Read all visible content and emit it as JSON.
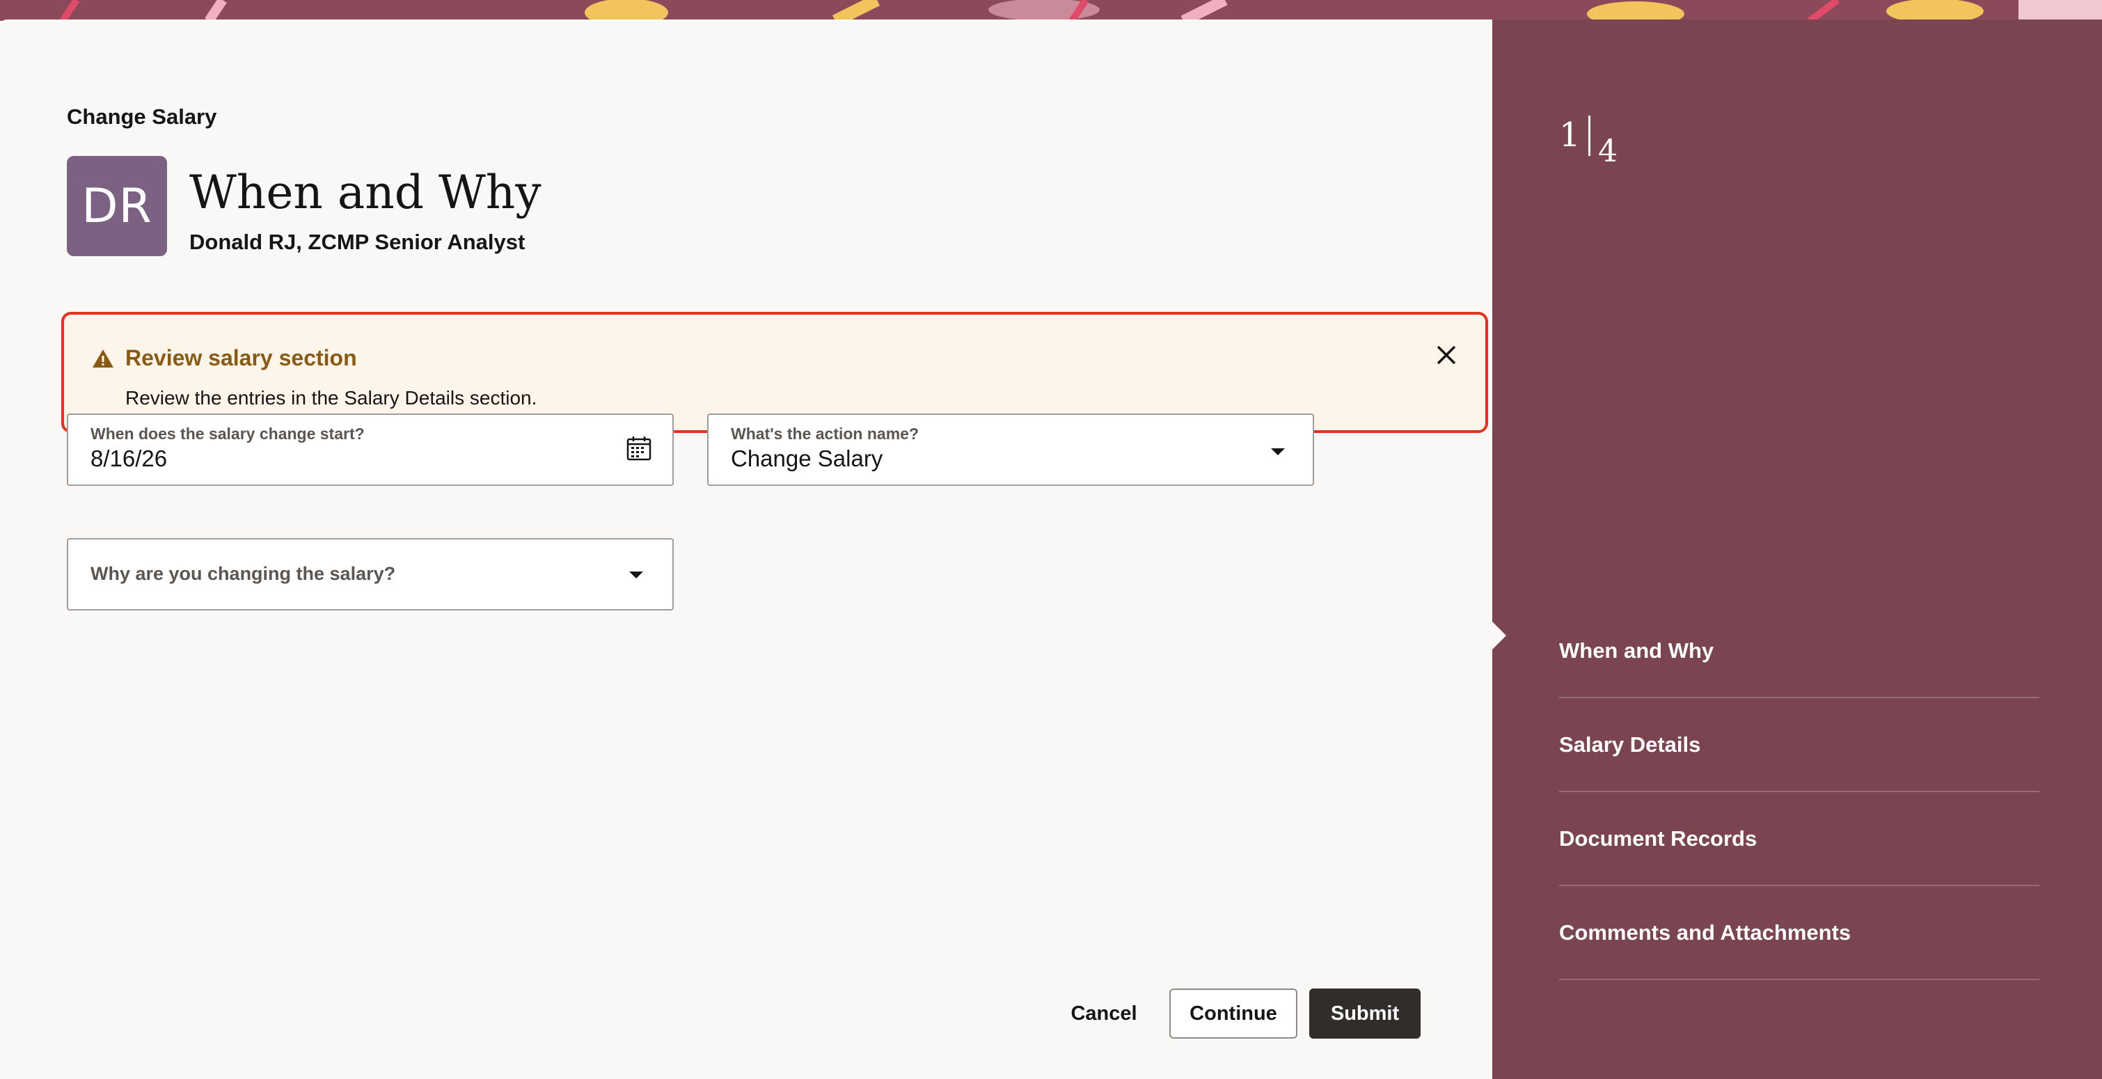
{
  "header": {
    "flow_title": "Change Salary",
    "avatar_initials": "DR",
    "step_title": "When and Why",
    "person_line": "Donald RJ, ZCMP Senior Analyst"
  },
  "alert": {
    "title": "Review salary section",
    "message": "Review the entries in the Salary Details section.",
    "icon": "warning-icon",
    "close_icon": "close-icon",
    "border_color": "#e3331f",
    "title_color": "#8a5a13"
  },
  "fields": {
    "start_date": {
      "label": "When does the salary change start?",
      "value": "8/16/26",
      "icon": "calendar-icon"
    },
    "action_name": {
      "label": "What's the action name?",
      "value": "Change Salary",
      "icon": "chevron-down-icon"
    },
    "reason": {
      "placeholder": "Why are you changing the salary?",
      "icon": "chevron-down-icon"
    }
  },
  "footer": {
    "cancel": "Cancel",
    "continue": "Continue",
    "submit": "Submit"
  },
  "progress": {
    "current": "1",
    "total": "4",
    "steps": [
      {
        "label": "When and Why",
        "active": true
      },
      {
        "label": "Salary Details",
        "active": false
      },
      {
        "label": "Document Records",
        "active": false
      },
      {
        "label": "Comments and Attachments",
        "active": false
      }
    ]
  },
  "colors": {
    "side_panel": "#7a4550",
    "main_panel": "#faf8f6",
    "avatar": "#7b6283",
    "submit_button": "#312d2a"
  }
}
